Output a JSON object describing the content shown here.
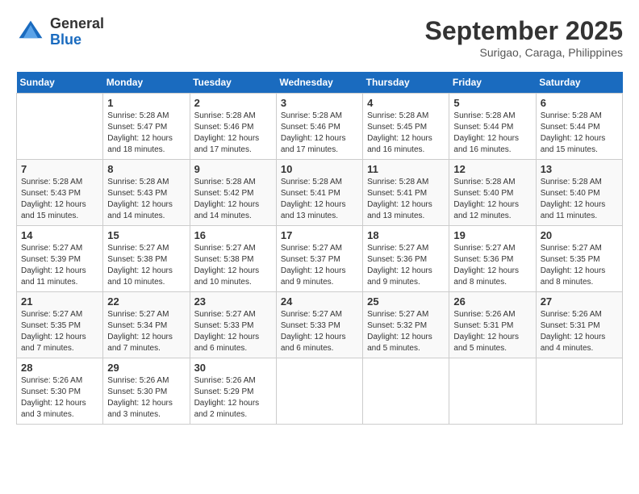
{
  "header": {
    "logo_general": "General",
    "logo_blue": "Blue",
    "month": "September 2025",
    "location": "Surigao, Caraga, Philippines"
  },
  "weekdays": [
    "Sunday",
    "Monday",
    "Tuesday",
    "Wednesday",
    "Thursday",
    "Friday",
    "Saturday"
  ],
  "weeks": [
    [
      {
        "day": "",
        "info": ""
      },
      {
        "day": "1",
        "info": "Sunrise: 5:28 AM\nSunset: 5:47 PM\nDaylight: 12 hours\nand 18 minutes."
      },
      {
        "day": "2",
        "info": "Sunrise: 5:28 AM\nSunset: 5:46 PM\nDaylight: 12 hours\nand 17 minutes."
      },
      {
        "day": "3",
        "info": "Sunrise: 5:28 AM\nSunset: 5:46 PM\nDaylight: 12 hours\nand 17 minutes."
      },
      {
        "day": "4",
        "info": "Sunrise: 5:28 AM\nSunset: 5:45 PM\nDaylight: 12 hours\nand 16 minutes."
      },
      {
        "day": "5",
        "info": "Sunrise: 5:28 AM\nSunset: 5:44 PM\nDaylight: 12 hours\nand 16 minutes."
      },
      {
        "day": "6",
        "info": "Sunrise: 5:28 AM\nSunset: 5:44 PM\nDaylight: 12 hours\nand 15 minutes."
      }
    ],
    [
      {
        "day": "7",
        "info": "Sunrise: 5:28 AM\nSunset: 5:43 PM\nDaylight: 12 hours\nand 15 minutes."
      },
      {
        "day": "8",
        "info": "Sunrise: 5:28 AM\nSunset: 5:43 PM\nDaylight: 12 hours\nand 14 minutes."
      },
      {
        "day": "9",
        "info": "Sunrise: 5:28 AM\nSunset: 5:42 PM\nDaylight: 12 hours\nand 14 minutes."
      },
      {
        "day": "10",
        "info": "Sunrise: 5:28 AM\nSunset: 5:41 PM\nDaylight: 12 hours\nand 13 minutes."
      },
      {
        "day": "11",
        "info": "Sunrise: 5:28 AM\nSunset: 5:41 PM\nDaylight: 12 hours\nand 13 minutes."
      },
      {
        "day": "12",
        "info": "Sunrise: 5:28 AM\nSunset: 5:40 PM\nDaylight: 12 hours\nand 12 minutes."
      },
      {
        "day": "13",
        "info": "Sunrise: 5:28 AM\nSunset: 5:40 PM\nDaylight: 12 hours\nand 11 minutes."
      }
    ],
    [
      {
        "day": "14",
        "info": "Sunrise: 5:27 AM\nSunset: 5:39 PM\nDaylight: 12 hours\nand 11 minutes."
      },
      {
        "day": "15",
        "info": "Sunrise: 5:27 AM\nSunset: 5:38 PM\nDaylight: 12 hours\nand 10 minutes."
      },
      {
        "day": "16",
        "info": "Sunrise: 5:27 AM\nSunset: 5:38 PM\nDaylight: 12 hours\nand 10 minutes."
      },
      {
        "day": "17",
        "info": "Sunrise: 5:27 AM\nSunset: 5:37 PM\nDaylight: 12 hours\nand 9 minutes."
      },
      {
        "day": "18",
        "info": "Sunrise: 5:27 AM\nSunset: 5:36 PM\nDaylight: 12 hours\nand 9 minutes."
      },
      {
        "day": "19",
        "info": "Sunrise: 5:27 AM\nSunset: 5:36 PM\nDaylight: 12 hours\nand 8 minutes."
      },
      {
        "day": "20",
        "info": "Sunrise: 5:27 AM\nSunset: 5:35 PM\nDaylight: 12 hours\nand 8 minutes."
      }
    ],
    [
      {
        "day": "21",
        "info": "Sunrise: 5:27 AM\nSunset: 5:35 PM\nDaylight: 12 hours\nand 7 minutes."
      },
      {
        "day": "22",
        "info": "Sunrise: 5:27 AM\nSunset: 5:34 PM\nDaylight: 12 hours\nand 7 minutes."
      },
      {
        "day": "23",
        "info": "Sunrise: 5:27 AM\nSunset: 5:33 PM\nDaylight: 12 hours\nand 6 minutes."
      },
      {
        "day": "24",
        "info": "Sunrise: 5:27 AM\nSunset: 5:33 PM\nDaylight: 12 hours\nand 6 minutes."
      },
      {
        "day": "25",
        "info": "Sunrise: 5:27 AM\nSunset: 5:32 PM\nDaylight: 12 hours\nand 5 minutes."
      },
      {
        "day": "26",
        "info": "Sunrise: 5:26 AM\nSunset: 5:31 PM\nDaylight: 12 hours\nand 5 minutes."
      },
      {
        "day": "27",
        "info": "Sunrise: 5:26 AM\nSunset: 5:31 PM\nDaylight: 12 hours\nand 4 minutes."
      }
    ],
    [
      {
        "day": "28",
        "info": "Sunrise: 5:26 AM\nSunset: 5:30 PM\nDaylight: 12 hours\nand 3 minutes."
      },
      {
        "day": "29",
        "info": "Sunrise: 5:26 AM\nSunset: 5:30 PM\nDaylight: 12 hours\nand 3 minutes."
      },
      {
        "day": "30",
        "info": "Sunrise: 5:26 AM\nSunset: 5:29 PM\nDaylight: 12 hours\nand 2 minutes."
      },
      {
        "day": "",
        "info": ""
      },
      {
        "day": "",
        "info": ""
      },
      {
        "day": "",
        "info": ""
      },
      {
        "day": "",
        "info": ""
      }
    ]
  ]
}
